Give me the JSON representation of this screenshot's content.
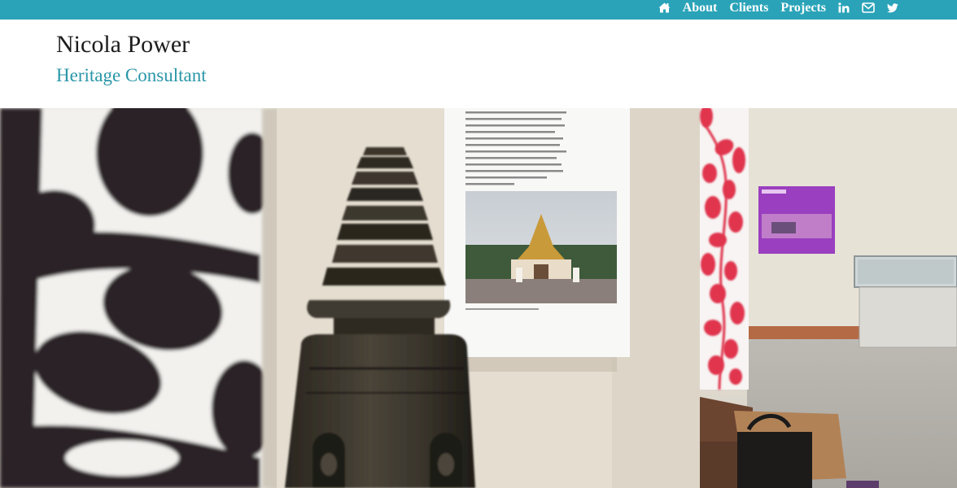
{
  "nav": {
    "home_icon": "home-icon",
    "items": [
      {
        "label": "About"
      },
      {
        "label": "Clients"
      },
      {
        "label": "Projects"
      }
    ],
    "social": [
      "linkedin-icon",
      "envelope-icon",
      "twitter-icon"
    ]
  },
  "header": {
    "title": "Nicola Power",
    "subtitle": "Heritage Consultant"
  },
  "hero": {
    "image": "museum-exhibit-photo"
  },
  "colors": {
    "accent": "#2aa3b8",
    "subtitle": "#2a96a8",
    "title": "#1c1c1c"
  }
}
